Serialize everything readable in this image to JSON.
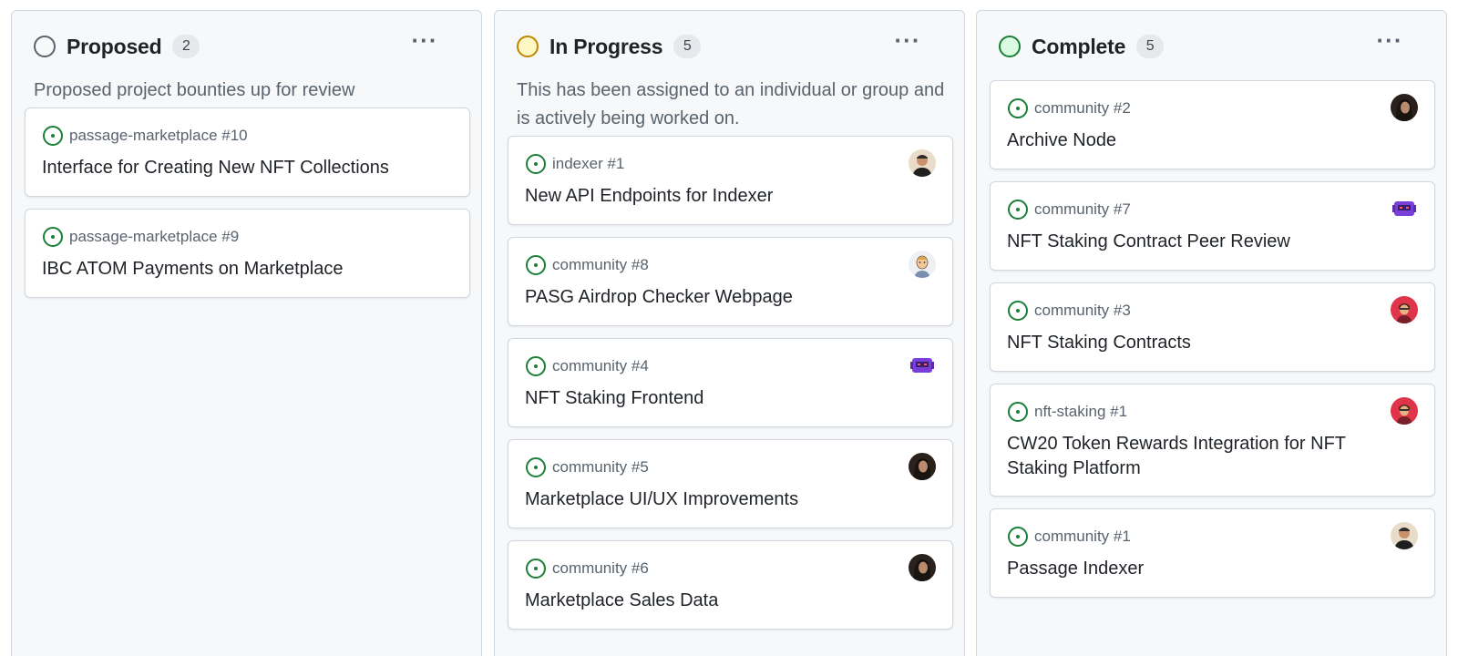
{
  "columns": [
    {
      "title": "Proposed",
      "count": "2",
      "status_color": "gray",
      "description": "Proposed project bounties up for review",
      "cards": [
        {
          "ref": "passage-marketplace #10",
          "title": "Interface for Creating New NFT Collections",
          "avatar": null
        },
        {
          "ref": "passage-marketplace #9",
          "title": "IBC ATOM Payments on Marketplace",
          "avatar": null
        }
      ]
    },
    {
      "title": "In Progress",
      "count": "5",
      "status_color": "yellow",
      "description": "This has been assigned to an individual or group and is actively being worked on.",
      "cards": [
        {
          "ref": "indexer #1",
          "title": "New API Endpoints for Indexer",
          "avatar": "avatar-man"
        },
        {
          "ref": "community #8",
          "title": "PASG Airdrop Checker Webpage",
          "avatar": "avatar-cartoon"
        },
        {
          "ref": "community #4",
          "title": "NFT Staking Frontend",
          "avatar": "avatar-purple-robot"
        },
        {
          "ref": "community #5",
          "title": "Marketplace UI/UX Improvements",
          "avatar": "avatar-dark-hair"
        },
        {
          "ref": "community #6",
          "title": "Marketplace Sales Data",
          "avatar": "avatar-dark-hair"
        }
      ]
    },
    {
      "title": "Complete",
      "count": "5",
      "status_color": "green",
      "description": "",
      "cards": [
        {
          "ref": "community #2",
          "title": "Archive Node",
          "avatar": "avatar-dark-hair"
        },
        {
          "ref": "community #7",
          "title": "NFT Staking Contract Peer Review",
          "avatar": "avatar-purple-robot"
        },
        {
          "ref": "community #3",
          "title": "NFT Staking Contracts",
          "avatar": "avatar-red"
        },
        {
          "ref": "nft-staking #1",
          "title": "CW20 Token Rewards Integration for NFT Staking Platform",
          "avatar": "avatar-red"
        },
        {
          "ref": "community #1",
          "title": "Passage Indexer",
          "avatar": "avatar-man"
        }
      ]
    }
  ],
  "colors": {
    "open_issue": "#1a7f37",
    "gray": "#59636e",
    "yellow": "#bf8700",
    "green": "#1a7f37"
  },
  "icons": {
    "status": "circle-icon",
    "open_issue": "issue-opened-icon",
    "menu": "kebab-horizontal-icon"
  }
}
